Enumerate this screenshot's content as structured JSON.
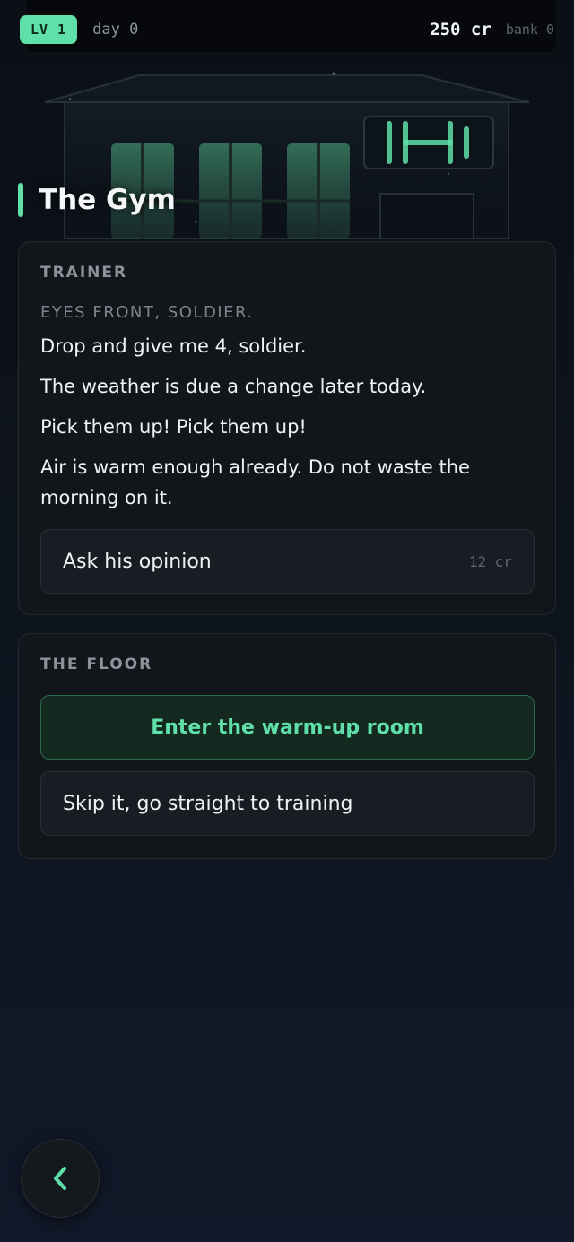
{
  "status": {
    "level": "LV 1",
    "day": "day 0",
    "credits": "250 cr",
    "bank": "bank 0"
  },
  "location": {
    "title": "The Gym",
    "sign_icon": "dumbbell-icon"
  },
  "trainer": {
    "section_label": "TRAINER",
    "subtitle": "EYES FRONT, SOLDIER.",
    "lines": [
      "Drop and give me 4, soldier.",
      "The weather is due a change later today.",
      "Pick them up! Pick them up!",
      "Air is warm enough already. Do not waste the morning on it."
    ],
    "option": {
      "label": "Ask his opinion",
      "cost": "12 cr"
    }
  },
  "floor": {
    "section_label": "THE FLOOR",
    "options": [
      {
        "label": "Enter the warm-up room",
        "primary": true
      },
      {
        "label": "Skip it, go straight to training",
        "primary": false
      }
    ]
  },
  "nav": {
    "back_icon": "chevron-left-icon"
  },
  "colors": {
    "accent": "#5fe0a8",
    "card_bg": "#121519",
    "primary_option_bg": "#142a20"
  }
}
